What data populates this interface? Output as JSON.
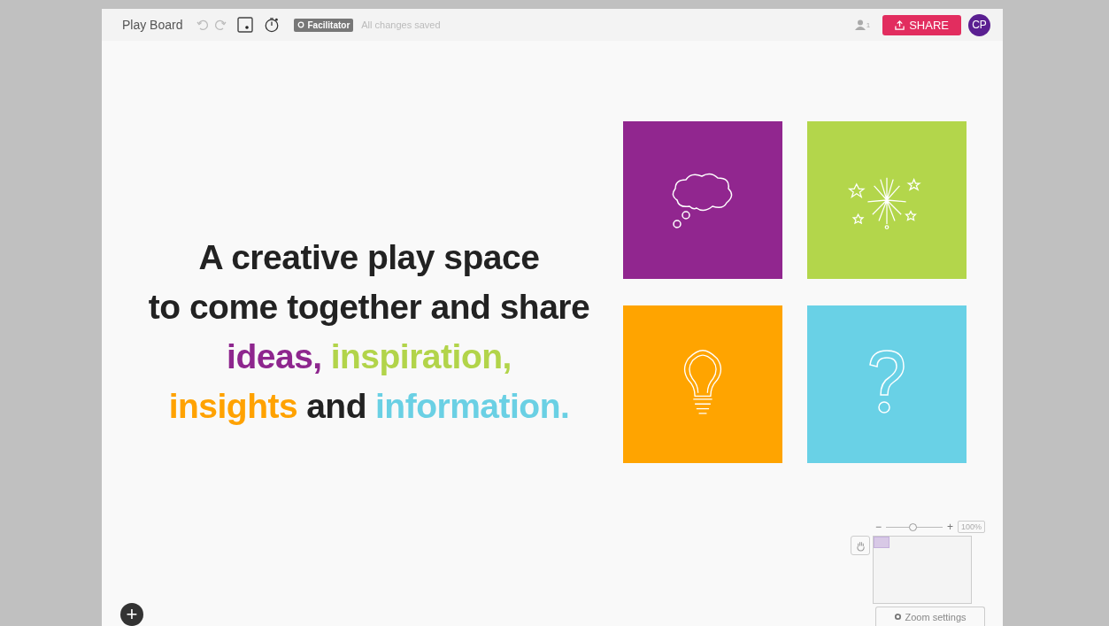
{
  "toolbar": {
    "board_title": "Play Board",
    "role_badge": "Facilitator",
    "save_status": "All changes saved",
    "participant_count": "1",
    "share_label": "SHARE",
    "avatar_initials": "CP"
  },
  "headline": {
    "lines": [
      [
        {
          "text": "A creative play space",
          "color": "#222222"
        }
      ],
      [
        {
          "text": "to come together and share",
          "color": "#222222"
        }
      ],
      [
        {
          "text": "ideas,",
          "color": "#8e268e"
        },
        {
          "text": "inspiration,",
          "color": "#b2d44a"
        }
      ],
      [
        {
          "text": "insights",
          "color": "#ffa200"
        },
        {
          "text": "and",
          "color": "#222222"
        },
        {
          "text": "information.",
          "color": "#6ad0e4"
        }
      ]
    ]
  },
  "tiles": [
    {
      "kind": "cloud",
      "color": "#91268f"
    },
    {
      "kind": "fireworks",
      "color": "#b3d64b"
    },
    {
      "kind": "bulb",
      "color": "#ffa400"
    },
    {
      "kind": "question",
      "color": "#69d1e6"
    }
  ],
  "zoom": {
    "minus": "−",
    "plus": "+",
    "level": 0.47,
    "percent": "100%",
    "settings_label": "Zoom settings"
  },
  "add_button": {
    "symbol": "+"
  }
}
